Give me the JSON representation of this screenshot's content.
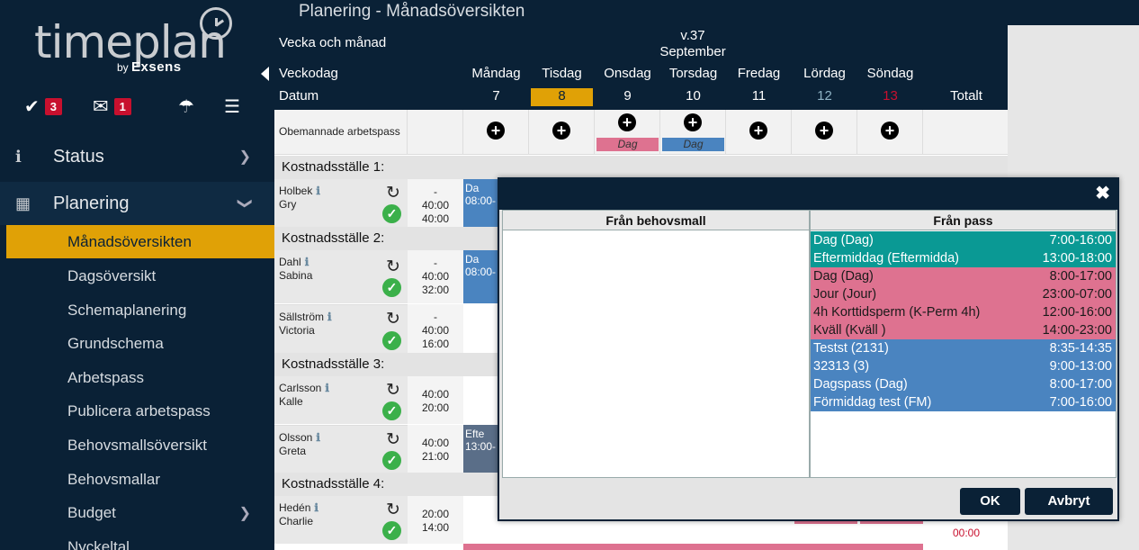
{
  "sidebar": {
    "logo": {
      "text": "timeplan",
      "by": "by",
      "brand": "Exsens"
    },
    "toolbar": {
      "tasks_badge": "3",
      "mail_badge": "1"
    },
    "nav": {
      "status": "Status",
      "planering": "Planering"
    },
    "sub": [
      "Månadsöversikten",
      "Dagsöversikt",
      "Schemaplanering",
      "Grundschema",
      "Arbetspass",
      "Publicera arbetspass",
      "Behovsmallsöversikt",
      "Behovsmallar",
      "Budget",
      "Nyckeltal"
    ]
  },
  "page": {
    "title": "Planering - Månadsöversikten"
  },
  "grid": {
    "labels": {
      "week_month": "Vecka och månad",
      "weekday": "Veckodag",
      "date": "Datum"
    },
    "week": "v.37",
    "month": "September",
    "days": [
      {
        "name": "Måndag",
        "date": "7"
      },
      {
        "name": "Tisdag",
        "date": "8"
      },
      {
        "name": "Onsdag",
        "date": "9"
      },
      {
        "name": "Torsdag",
        "date": "10"
      },
      {
        "name": "Fredag",
        "date": "11"
      },
      {
        "name": "Lördag",
        "date": "12"
      },
      {
        "name": "Söndag",
        "date": "13"
      }
    ],
    "total_label": "Totalt",
    "unstaffed_label": "Obemannade arbetspass",
    "unstaffed_tags": {
      "wed": "Dag",
      "thu": "Dag"
    },
    "sections": [
      "Kostnadsställe 1:",
      "Kostnadsställe 2:",
      "Kostnadsställe 3:",
      "Kostnadsställe 4:"
    ],
    "employees": [
      {
        "last": "Holbek",
        "first": "Gry",
        "h1": "-",
        "h2": "40:00",
        "h3": "40:00",
        "shift": "Da",
        "shift_time": "08:00-"
      },
      {
        "last": "Dahl",
        "first": "Sabina",
        "h1": "-",
        "h2": "40:00",
        "h3": "32:00",
        "shift": "Da",
        "shift_time": "08:00-"
      },
      {
        "last": "Sällström",
        "first": "Victoria",
        "h1": "-",
        "h2": "40:00",
        "h3": "16:00"
      },
      {
        "last": "Carlsson",
        "first": "Kalle",
        "h1": "40:00",
        "h2": "20:00"
      },
      {
        "last": "Olsson",
        "first": "Greta",
        "h1": "40:00",
        "h2": "21:00",
        "shift": "Efte",
        "shift_time": "13:00-"
      },
      {
        "last": "Hedén",
        "first": "Charlie",
        "h1": "20:00",
        "h2": "14:00"
      }
    ],
    "bottom_total": "00:00"
  },
  "modal": {
    "left_title": "Från behovsmall",
    "right_title": "Från pass",
    "items": [
      {
        "name": "Dag (Dag)",
        "time": "7:00-16:00",
        "color": "#0a9994"
      },
      {
        "name": "Eftermiddag (Eftermidda)",
        "time": "13:00-18:00",
        "color": "#0a9994"
      },
      {
        "name": "Dag (Dag)",
        "time": "8:00-17:00",
        "color": "#de7290"
      },
      {
        "name": "Jour (Jour)",
        "time": "23:00-07:00",
        "color": "#de7290"
      },
      {
        "name": "4h Korttidsperm (K-Perm 4h)",
        "time": "12:00-16:00",
        "color": "#de7290"
      },
      {
        "name": "Kväll (Kväll )",
        "time": "14:00-23:00",
        "color": "#de7290"
      },
      {
        "name": "Testst (2131)",
        "time": "8:35-14:35",
        "color": "#4a84c0"
      },
      {
        "name": "32313 (3)",
        "time": "9:00-13:00",
        "color": "#4a84c0"
      },
      {
        "name": "Dagspass (Dag)",
        "time": "8:00-17:00",
        "color": "#4a84c0"
      },
      {
        "name": "Förmiddag test (FM)",
        "time": "7:00-16:00",
        "color": "#4a84c0"
      }
    ],
    "ok": "OK",
    "cancel": "Avbryt"
  },
  "colors": {
    "navy": "#0a2136",
    "accent": "#e0a106",
    "teal": "#0a9994",
    "pink": "#de7290",
    "blue": "#4a84c0",
    "weekend_sat": "#8fb3c5",
    "weekend_sun": "#c8102e"
  }
}
